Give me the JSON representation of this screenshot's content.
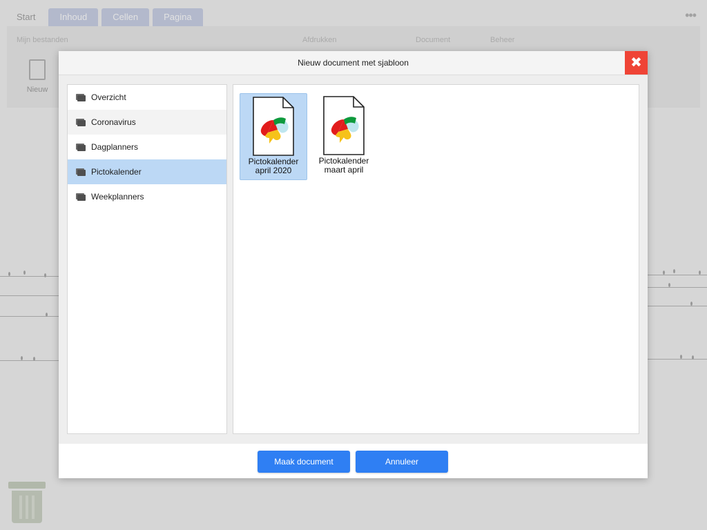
{
  "background": {
    "tabs": [
      "Start",
      "Inhoud",
      "Cellen",
      "Pagina"
    ],
    "more_icon": "ellipsis-icon",
    "ribbon_groups": [
      "Mijn bestanden",
      "Afdrukken",
      "Document",
      "Beheer"
    ],
    "new_button_label": "Nieuw"
  },
  "dialog": {
    "title": "Nieuw document met sjabloon",
    "close_icon": "close-icon",
    "folders": [
      {
        "label": "Overzicht",
        "icon": "folder-icon"
      },
      {
        "label": "Coronavirus",
        "icon": "folder-icon"
      },
      {
        "label": "Dagplanners",
        "icon": "folder-icon"
      },
      {
        "label": "Pictokalender",
        "icon": "folder-icon",
        "selected": true
      },
      {
        "label": "Weekplanners",
        "icon": "folder-icon"
      }
    ],
    "templates": [
      {
        "line1": "Pictokalender",
        "line2": "april 2020",
        "selected": true
      },
      {
        "line1": "Pictokalender",
        "line2": "maart april",
        "selected": false
      }
    ],
    "buttons": {
      "create": "Maak document",
      "cancel": "Annuleer"
    },
    "accent_color": "#2f7ff3",
    "close_color": "#ef4436",
    "selection_color": "#bcd8f5"
  }
}
